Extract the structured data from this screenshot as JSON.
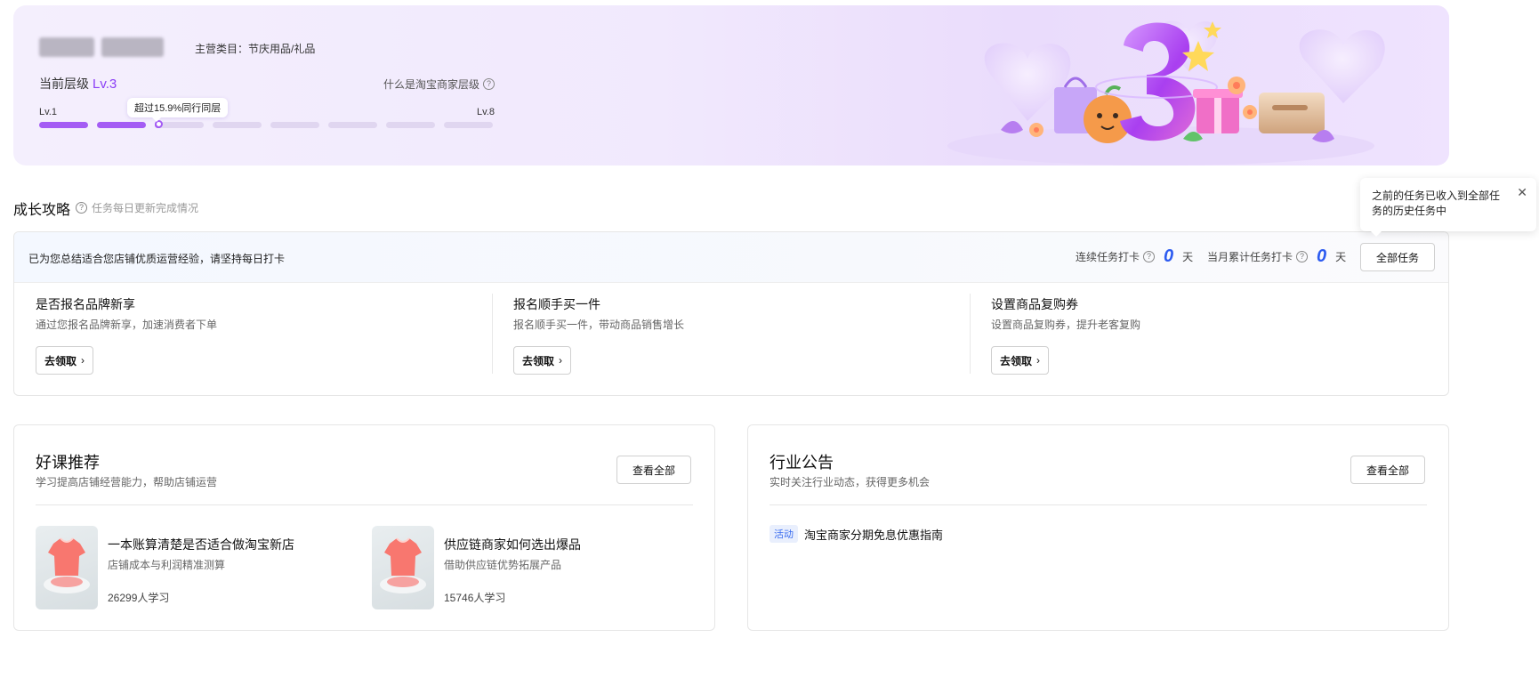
{
  "banner": {
    "category": "主营类目：节庆用品/礼品",
    "current_level_label": "当前层级",
    "current_level": "Lv.3",
    "what_level": "什么是淘宝商家层级",
    "lv_min": "Lv.1",
    "lv_max": "Lv.8",
    "exceed_tip": "超过15.9%同行同层",
    "progress": {
      "total_segments": 8,
      "full_segments": 2,
      "partial_fraction": 0.1
    }
  },
  "growth": {
    "title": "成长攻略",
    "subtitle": "任务每日更新完成情况",
    "popup_text": "之前的任务已收入到全部任务的历史任务中"
  },
  "task_card": {
    "head_text": "已为您总结适合您店铺优质运营经验，请坚持每日打卡",
    "streak_label": "连续任务打卡",
    "streak_value": "0",
    "month_label": "当月累计任务打卡",
    "month_value": "0",
    "day_unit": "天",
    "all_tasks": "全部任务",
    "tasks": [
      {
        "title": "是否报名品牌新享",
        "desc": "通过您报名品牌新享，加速消费者下单",
        "button": "去领取"
      },
      {
        "title": "报名顺手买一件",
        "desc": "报名顺手买一件，带动商品销售增长",
        "button": "去领取"
      },
      {
        "title": "设置商品复购券",
        "desc": "设置商品复购券，提升老客复购",
        "button": "去领取"
      }
    ]
  },
  "courses": {
    "title": "好课推荐",
    "subtitle": "学习提高店铺经营能力，帮助店铺运营",
    "view_all": "查看全部",
    "items": [
      {
        "title": "一本账算清楚是否适合做淘宝新店",
        "desc": "店铺成本与利润精准测算",
        "count": "26299人学习"
      },
      {
        "title": "供应链商家如何选出爆品",
        "desc": "借助供应链优势拓展产品",
        "count": "15746人学习"
      }
    ]
  },
  "notices": {
    "title": "行业公告",
    "subtitle": "实时关注行业动态，获得更多机会",
    "view_all": "查看全部",
    "items": [
      {
        "tag": "活动",
        "text": "淘宝商家分期免息优惠指南"
      }
    ]
  },
  "colors": {
    "accent_purple": "#a45cf4",
    "accent_blue": "#2c5bf0",
    "tag_blue": "#3a6df0"
  }
}
